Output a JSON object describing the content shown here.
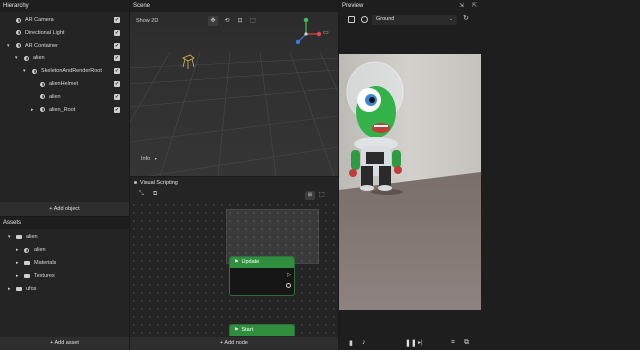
{
  "hierarchy": {
    "title": "Hierarchy",
    "items": [
      {
        "label": "AR Camera",
        "depth": 0,
        "expandable": false
      },
      {
        "label": "Directional Light",
        "depth": 0,
        "expandable": false
      },
      {
        "label": "AR Container",
        "depth": 0,
        "expandable": true
      },
      {
        "label": "alien",
        "depth": 1,
        "expandable": true
      },
      {
        "label": "SkeletonAndRenderRoot",
        "depth": 2,
        "expandable": true
      },
      {
        "label": "alienHelmet",
        "depth": 3,
        "expandable": false
      },
      {
        "label": "alien",
        "depth": 3,
        "expandable": false
      },
      {
        "label": "alien_Root",
        "depth": 3,
        "expandable": true,
        "collapsed": true
      }
    ],
    "add_label": "+ Add object"
  },
  "assets": {
    "title": "Assets",
    "items": [
      {
        "label": "alien",
        "depth": 0,
        "expanded": true,
        "type": "folder"
      },
      {
        "label": "alien",
        "depth": 1,
        "type": "object"
      },
      {
        "label": "Materials",
        "depth": 1,
        "type": "folder"
      },
      {
        "label": "Textures",
        "depth": 1,
        "type": "folder"
      },
      {
        "label": "ufos",
        "depth": 0,
        "type": "folder"
      }
    ],
    "add_label": "+ Add asset"
  },
  "scene": {
    "title": "Scene",
    "show2d": "Show 2D",
    "info": "Info",
    "gizmo": {
      "y": "y",
      "x": "x",
      "z": "z"
    }
  },
  "visual_scripting": {
    "title": "Visual Scripting",
    "nodes": [
      {
        "label": "Update"
      },
      {
        "label": "Start"
      }
    ],
    "add_label": "+ Add node"
  },
  "preview": {
    "title": "Preview",
    "ground_select": "Ground"
  }
}
